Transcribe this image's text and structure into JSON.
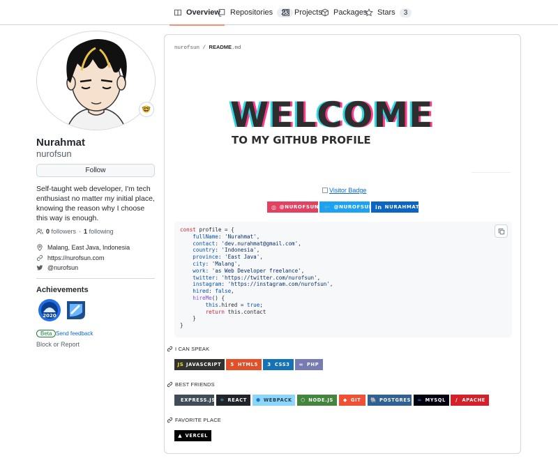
{
  "nav": {
    "tabs": [
      {
        "label": "Overview",
        "icon": "book-icon",
        "active": true
      },
      {
        "label": "Repositories",
        "icon": "repo-icon",
        "count": "23"
      },
      {
        "label": "Projects",
        "icon": "project-icon"
      },
      {
        "label": "Packages",
        "icon": "package-icon"
      },
      {
        "label": "Stars",
        "icon": "star-icon",
        "count": "3"
      }
    ]
  },
  "profile": {
    "name": "Nurahmat",
    "login": "nurofsun",
    "status_emoji": "🤓",
    "follow_label": "Follow",
    "bio": "Self-taught web developer, I'm tech enthusiast no matter my initial place, knowing the reason why I choose this way is enough.",
    "followers_count": "0",
    "followers_label": "followers",
    "dot": "·",
    "following_count": "1",
    "following_label": "following",
    "location": "Malang, East Java, Indonesia",
    "website": "https://nurofsun.com",
    "twitter": "@nurofsun"
  },
  "achievements": {
    "title": "Achievements",
    "beta_label": "Beta",
    "feedback_label": "Send feedback",
    "block_label": "Block or Report"
  },
  "readme": {
    "crumb_user": "nurofsun",
    "crumb_sep": " / ",
    "crumb_file": "README",
    "crumb_ext": ".md",
    "welcome": "WELCOME",
    "welcome_sub": "TO MY GITHUB PROFILE",
    "visitor_badge": "Visitor Badge",
    "social": [
      {
        "label": "@NUROFSUN",
        "color": "#e4405f",
        "glyph": "◎"
      },
      {
        "label": "@NUROFSUN",
        "color": "#1da1f2",
        "glyph": "🐦"
      },
      {
        "label": "NURAHMAT",
        "color": "#0a66c2",
        "glyph": "in"
      }
    ],
    "code_lines": [
      [
        [
          "k",
          "const "
        ],
        [
          "",
          "profile = {"
        ]
      ],
      [
        [
          "",
          "    "
        ],
        [
          "p",
          "fullName"
        ],
        [
          "",
          ": "
        ],
        [
          "s",
          "'Nurahmat'"
        ],
        [
          "",
          ","
        ]
      ],
      [
        [
          "",
          "    "
        ],
        [
          "p",
          "contact"
        ],
        [
          "",
          ": "
        ],
        [
          "s",
          "'dev.nurahmat@gmail.com'"
        ],
        [
          "",
          ","
        ]
      ],
      [
        [
          "",
          "    "
        ],
        [
          "p",
          "country"
        ],
        [
          "",
          ": "
        ],
        [
          "s",
          "'Indonesia'"
        ],
        [
          "",
          ","
        ]
      ],
      [
        [
          "",
          "    "
        ],
        [
          "p",
          "province"
        ],
        [
          "",
          ": "
        ],
        [
          "s",
          "'East Java'"
        ],
        [
          "",
          ","
        ]
      ],
      [
        [
          "",
          "    "
        ],
        [
          "p",
          "city"
        ],
        [
          "",
          ": "
        ],
        [
          "s",
          "'Malang'"
        ],
        [
          "",
          ","
        ]
      ],
      [
        [
          "",
          "    "
        ],
        [
          "p",
          "work"
        ],
        [
          "",
          ": "
        ],
        [
          "s",
          "'as Web Developer freelance'"
        ],
        [
          "",
          ","
        ]
      ],
      [
        [
          "",
          "    "
        ],
        [
          "p",
          "twitter"
        ],
        [
          "",
          ": "
        ],
        [
          "s",
          "'https://twitter.com/nurofsun'"
        ],
        [
          "",
          ","
        ]
      ],
      [
        [
          "",
          "    "
        ],
        [
          "p",
          "instagram"
        ],
        [
          "",
          ": "
        ],
        [
          "s",
          "'https://instagram.com/nurofsun'"
        ],
        [
          "",
          ","
        ]
      ],
      [
        [
          "",
          "    "
        ],
        [
          "p",
          "hired"
        ],
        [
          "",
          ": "
        ],
        [
          "p",
          "false"
        ],
        [
          "",
          ","
        ]
      ],
      [
        [
          "",
          "    "
        ],
        [
          "f",
          "hireMe"
        ],
        [
          "",
          "() {"
        ]
      ],
      [
        [
          "",
          "        "
        ],
        [
          "p",
          "this"
        ],
        [
          "",
          ".hired = "
        ],
        [
          "p",
          "true"
        ],
        [
          "",
          ";"
        ]
      ],
      [
        [
          "",
          "        "
        ],
        [
          "k",
          "return "
        ],
        [
          "",
          "this.contact"
        ]
      ],
      [
        [
          "",
          "    }"
        ]
      ],
      [
        [
          "",
          "}"
        ]
      ]
    ],
    "speak_title": "I CAN SPEAK",
    "speak": [
      {
        "label": "JAVASCRIPT",
        "color": "#323330",
        "glyph": "JS",
        "glyph_color": "#f7df1e"
      },
      {
        "label": "HTML5",
        "color": "#e34f26",
        "glyph": "5",
        "glyph_color": "#ffffff"
      },
      {
        "label": "CSS3",
        "color": "#1572b6",
        "glyph": "3",
        "glyph_color": "#ffffff"
      },
      {
        "label": "PHP",
        "color": "#777bb4",
        "glyph": "∞",
        "glyph_color": "#ffffff"
      }
    ],
    "friends_title": "BEST FRIENDS",
    "friends": [
      {
        "label": "EXPRESS.JS",
        "color": "#404d59",
        "glyph": "",
        "glyph_color": "#ffffff"
      },
      {
        "label": "REACT",
        "color": "#20232a",
        "glyph": "⚛",
        "glyph_color": "#61dafb"
      },
      {
        "label": "WEBPACK",
        "color": "#8dd6f9",
        "glyph": "⬢",
        "glyph_color": "#1c78c0",
        "text_color": "#1c3b4f"
      },
      {
        "label": "NODE.JS",
        "color": "#43853d",
        "glyph": "⬡",
        "glyph_color": "#ffffff"
      },
      {
        "label": "GIT",
        "color": "#f05033",
        "glyph": "◆",
        "glyph_color": "#ffffff"
      },
      {
        "label": "POSTGRES",
        "color": "#316192",
        "glyph": "🐘",
        "glyph_color": "#ffffff"
      },
      {
        "label": "MYSQL",
        "color": "#00000f",
        "glyph": "≈",
        "glyph_color": "#4479a1"
      },
      {
        "label": "APACHE",
        "color": "#d42029",
        "glyph": "/",
        "glyph_color": "#ffffff"
      }
    ],
    "place_title": "FAVORITE PLACE",
    "place": [
      {
        "label": "VERCEL",
        "color": "#000000",
        "glyph": "▲",
        "glyph_color": "#ffffff"
      }
    ]
  },
  "colors": {
    "accent": "#fd8c73",
    "link": "#0969da",
    "border": "#d0d7de"
  }
}
